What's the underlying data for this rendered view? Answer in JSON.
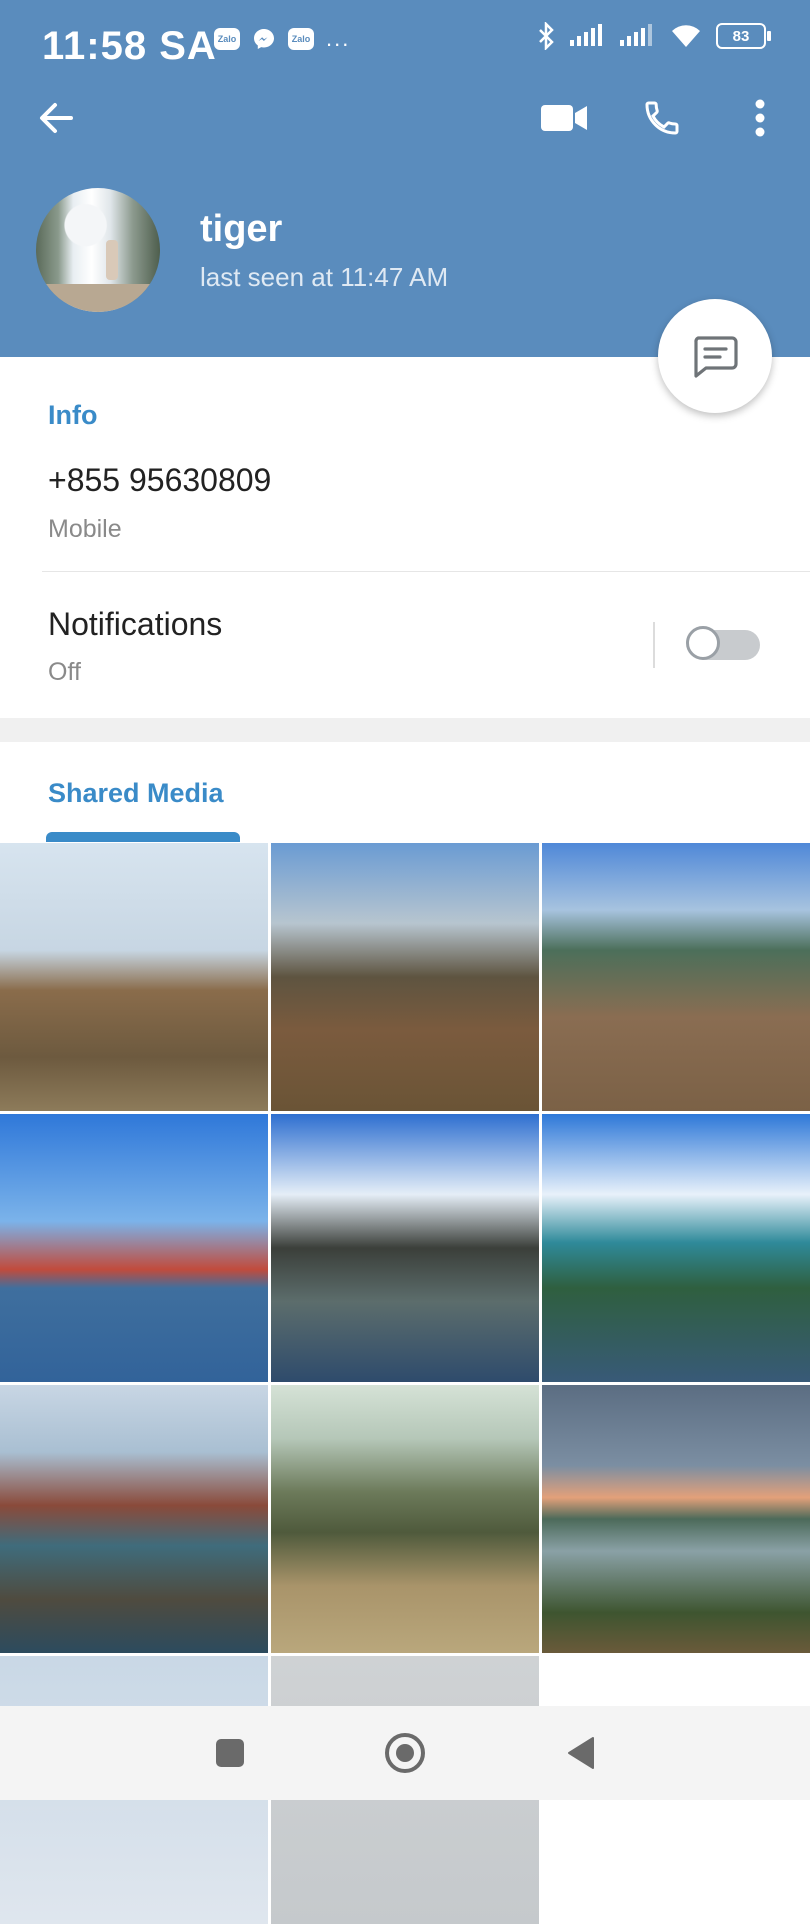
{
  "status_bar": {
    "time": "11:58 SA",
    "notification_icons": [
      "Zalo",
      "messenger-icon",
      "Zalo",
      "..."
    ],
    "battery": "83"
  },
  "toolbar": {
    "back": "back-arrow-icon",
    "video_call": "video-call-icon",
    "call": "phone-icon",
    "more": "more-vert-icon"
  },
  "profile": {
    "name": "tiger",
    "status": "last seen at 11:47 AM"
  },
  "info": {
    "title": "Info",
    "phone": "+855 95630809",
    "phone_label": "Mobile"
  },
  "notifications": {
    "label": "Notifications",
    "value": "Off",
    "enabled": false
  },
  "shared_media": {
    "title": "Shared Media",
    "count_visible": 11
  },
  "colors": {
    "header": "#5a8cbd",
    "accent": "#3a8bc8"
  }
}
